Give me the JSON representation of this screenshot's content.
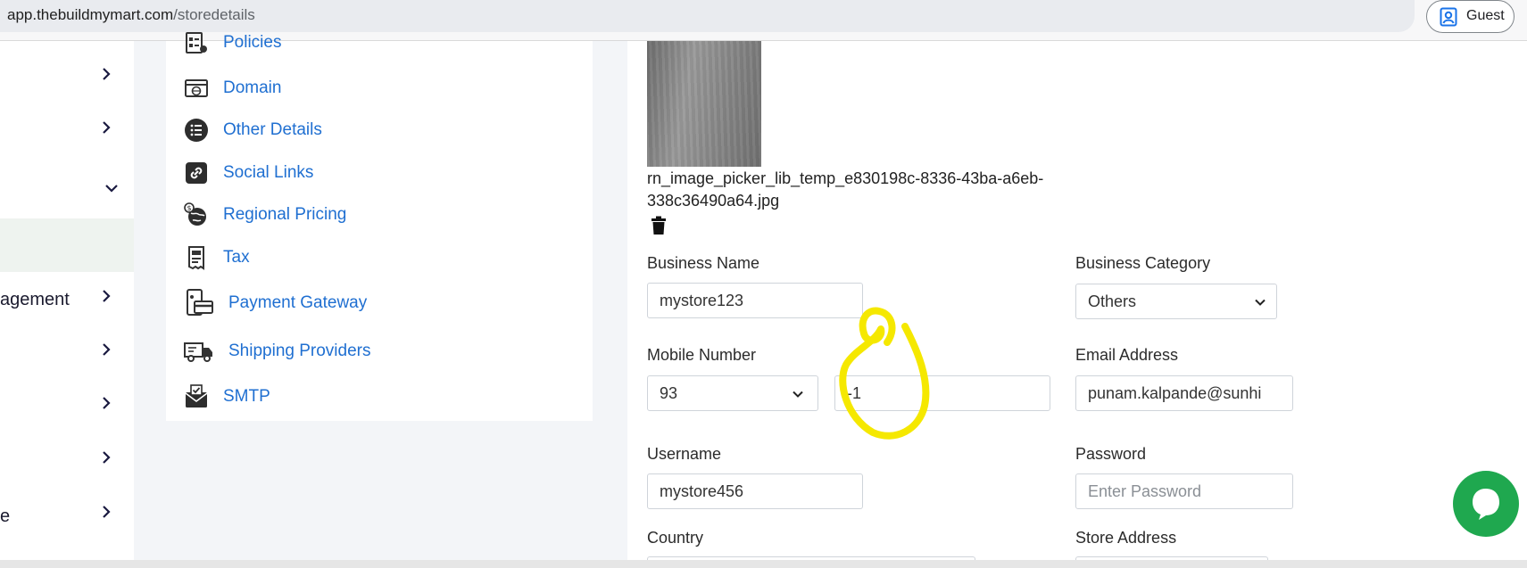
{
  "browser": {
    "url_host": "app.thebuildmymart.com",
    "url_path": "/storedetails",
    "profile_label": "Guest"
  },
  "left_nav": {
    "items": [
      {
        "text": ""
      },
      {
        "text": ""
      },
      {
        "text": ""
      },
      {
        "text": "agement"
      },
      {
        "text": ""
      },
      {
        "text": ""
      },
      {
        "text": ""
      },
      {
        "text": "e"
      }
    ]
  },
  "settings_menu": {
    "items": [
      {
        "label": "Policies",
        "icon": "policies-icon"
      },
      {
        "label": "Domain",
        "icon": "domain-icon"
      },
      {
        "label": "Other Details",
        "icon": "list-icon"
      },
      {
        "label": "Social Links",
        "icon": "link-icon"
      },
      {
        "label": "Regional Pricing",
        "icon": "globe-dollar-icon"
      },
      {
        "label": "Tax",
        "icon": "tax-receipt-icon"
      },
      {
        "label": "Payment Gateway",
        "icon": "payment-icon"
      },
      {
        "label": "Shipping Providers",
        "icon": "truck-icon"
      },
      {
        "label": "SMTP",
        "icon": "mail-check-icon"
      }
    ]
  },
  "form": {
    "image_filename": "rn_image_picker_lib_temp_e830198c-8336-43ba-a6eb-338c36490a64.jpg",
    "business_name": {
      "label": "Business Name",
      "value": "mystore123"
    },
    "business_category": {
      "label": "Business Category",
      "value": "Others"
    },
    "mobile_number": {
      "label": "Mobile Number",
      "country_code": "93",
      "value": "-1"
    },
    "email_address": {
      "label": "Email Address",
      "value": "punam.kalpande@sunhi"
    },
    "username": {
      "label": "Username",
      "value": "mystore456"
    },
    "password": {
      "label": "Password",
      "placeholder": "Enter Password"
    },
    "country": {
      "label": "Country"
    },
    "store_address": {
      "label": "Store Address"
    }
  },
  "colors": {
    "link_blue": "#1f6fd1",
    "annotation_yellow": "#f5e800",
    "chat_green": "#1fa84f"
  }
}
